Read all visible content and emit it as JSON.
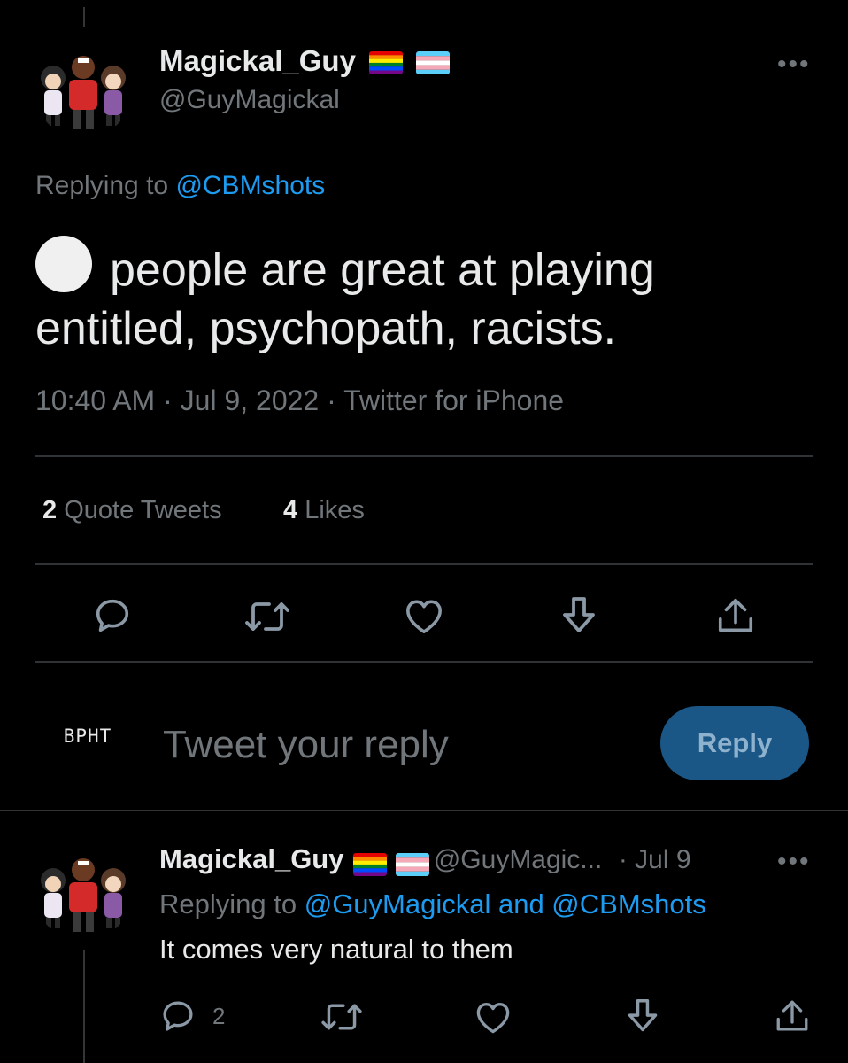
{
  "main_tweet": {
    "display_name": "Magickal_Guy",
    "handle": "@GuyMagickal",
    "replying_prefix": "Replying to",
    "replying_to": "@CBMshots",
    "text": "people are great at playing entitled, psychopath, racists.",
    "timestamp": "10:40 AM · Jul 9, 2022 · Twitter for iPhone",
    "quote_count": "2",
    "quote_label": "Quote Tweets",
    "like_count": "4",
    "like_label": "Likes",
    "more": "•••"
  },
  "actions": [
    "reply-icon",
    "retweet-icon",
    "like-icon",
    "bookmark-icon",
    "share-icon"
  ],
  "composer": {
    "avatar_text": "BPHT",
    "placeholder": "Tweet your reply",
    "reply_button": "Reply"
  },
  "reply_tweet": {
    "display_name": "Magickal_Guy",
    "handle": "@GuyMagic...",
    "date": "· Jul 9",
    "replying_prefix": "Replying to",
    "replying_to": "@GuyMagickal and @CBMshots",
    "text": "It comes very natural to them",
    "reply_count": "2",
    "more": "•••"
  },
  "colors": {
    "background": "#000000",
    "link": "#1d9bf0",
    "muted": "#71767b",
    "reply_button": "#1a5786"
  }
}
